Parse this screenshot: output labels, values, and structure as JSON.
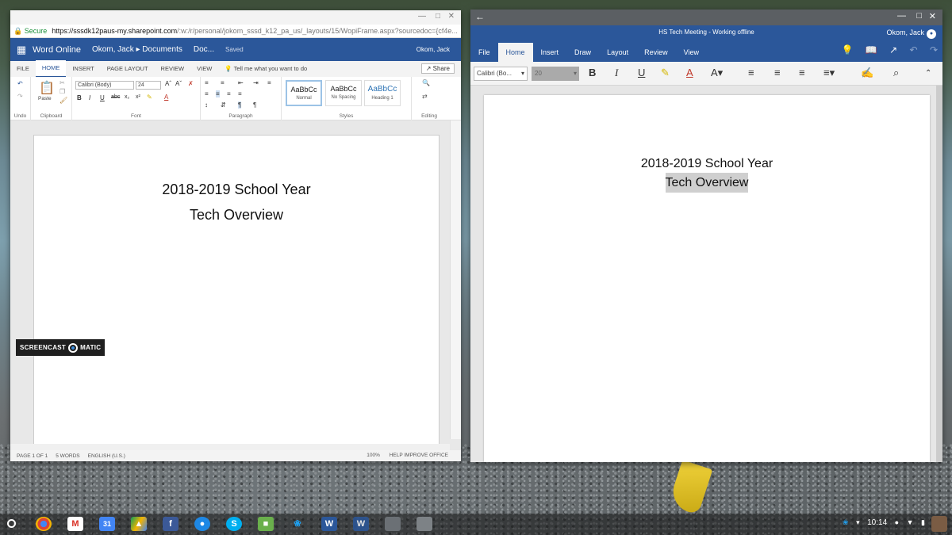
{
  "word_online": {
    "url_secure": "Secure",
    "url_host": "https://sssdk12paus-my.sharepoint.com",
    "url_rest": "/:w:/r/personal/jokom_sssd_k12_pa_us/_layouts/15/WopiFrame.aspx?sourcedoc={cf4e...",
    "app_name": "Word Online",
    "breadcrumb": "Okom, Jack ▸ Documents",
    "doc_name": "Doc...",
    "save_state": "Saved",
    "user_name": "Okom, Jack",
    "tabs": [
      "FILE",
      "HOME",
      "INSERT",
      "PAGE LAYOUT",
      "REVIEW",
      "VIEW"
    ],
    "tell_me": "Tell me what you want to do",
    "share": "Share",
    "undo_label": "Undo",
    "paste_label": "Paste",
    "clipboard_label": "Clipboard",
    "font_name": "Calibri (Body)",
    "font_size": "24",
    "font_label": "Font",
    "paragraph_label": "Paragraph",
    "styles_label": "Styles",
    "editing_label": "Editing",
    "styles": [
      {
        "sample": "AaBbCc",
        "name": "Normal"
      },
      {
        "sample": "AaBbCc",
        "name": "No Spacing"
      },
      {
        "sample": "AaBbCc",
        "name": "Heading 1"
      }
    ],
    "doc_line1": "2018-2019 School Year",
    "doc_line2": "Tech Overview",
    "status_page": "PAGE 1 OF 1",
    "status_words": "5 WORDS",
    "status_lang": "ENGLISH (U.S.)",
    "status_zoom": "100%",
    "status_help": "HELP IMPROVE OFFICE"
  },
  "watermark": {
    "left": "SCREENCAST",
    "right": "MATIC"
  },
  "word_app": {
    "title": "HS Tech Meeting - Working offline",
    "user_name": "Okom, Jack",
    "tabs": [
      "File",
      "Home",
      "Insert",
      "Draw",
      "Layout",
      "Review",
      "View"
    ],
    "font_name": "Calibri (Bo...",
    "font_size": "20",
    "doc_line1": "2018-2019 School Year",
    "doc_line2": "Tech Overview"
  },
  "taskbar": {
    "time": "10:14"
  },
  "colors": {
    "word_blue": "#2b579a"
  }
}
